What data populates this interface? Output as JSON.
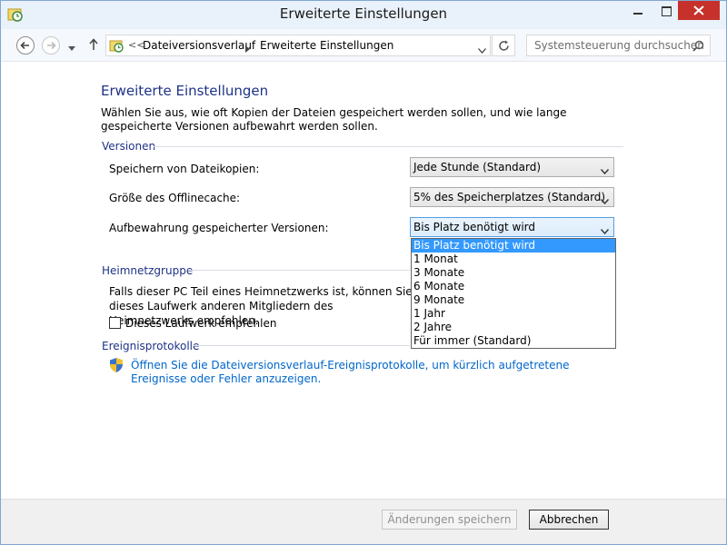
{
  "window": {
    "title": "Erweiterte Einstellungen",
    "accent_color": "#c7312c"
  },
  "address_bar": {
    "separator": "<<",
    "breadcrumbs": [
      "Dateiversionsverlauf",
      "Erweiterte Einstellungen"
    ],
    "search_placeholder": "Systemsteuerung durchsuchen"
  },
  "page": {
    "heading": "Erweiterte Einstellungen",
    "intro": "Wählen Sie aus, wie oft Kopien der Dateien gespeichert werden sollen, und wie lange gespeicherte Versionen aufbewahrt werden sollen."
  },
  "versions": {
    "title": "Versionen",
    "rows": [
      {
        "label": "Speichern von Dateikopien:",
        "value": "Jede Stunde (Standard)"
      },
      {
        "label": "Größe des Offlinecache:",
        "value": "5% des Speicherplatzes (Standard)"
      },
      {
        "label": "Aufbewahrung gespeicherter Versionen:",
        "value": "Bis Platz benötigt wird"
      }
    ],
    "dropdown_options": [
      "Bis Platz benötigt wird",
      "1 Monat",
      "3 Monate",
      "6 Monate",
      "9 Monate",
      "1 Jahr",
      "2 Jahre",
      "Für immer (Standard)"
    ],
    "selected_option": "Bis Platz benötigt wird"
  },
  "homegroup": {
    "title": "Heimnetzgruppe",
    "text": "Falls dieser PC Teil eines Heimnetzwerks ist, können Sie dieses Laufwerk anderen Mitgliedern des Heimnetzwerks empfehlen.",
    "checkbox_label": "Dieses Laufwerk empfehlen",
    "checked": false
  },
  "eventlog": {
    "title": "Ereignisprotokolle",
    "link": "Öffnen Sie die Dateiversionsverlauf-Ereignisprotokolle, um kürzlich aufgetretene Ereignisse oder Fehler anzuzeigen."
  },
  "footer": {
    "save_label": "Änderungen speichern",
    "cancel_label": "Abbrechen"
  }
}
